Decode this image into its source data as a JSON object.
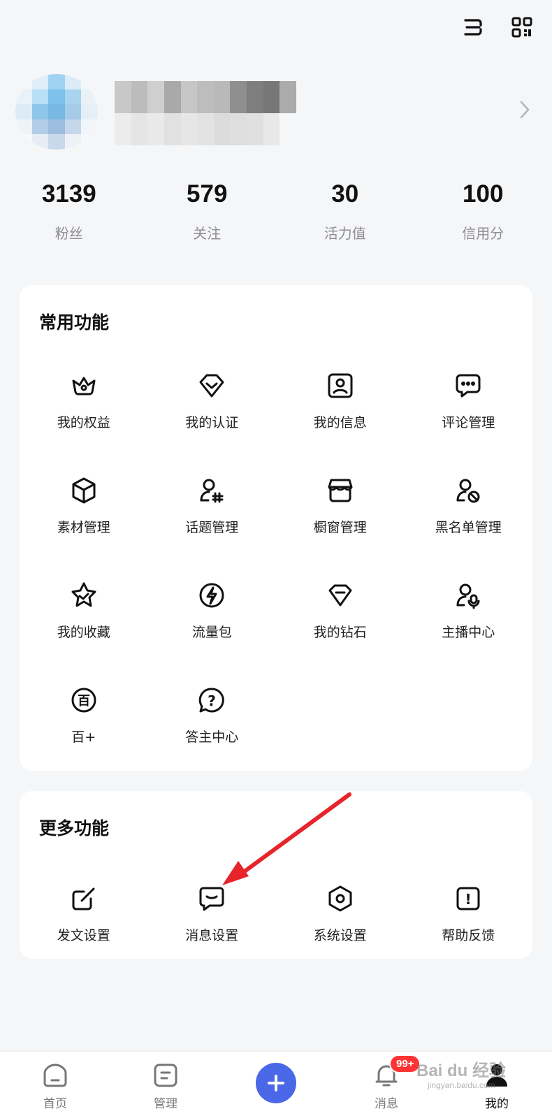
{
  "stats": [
    {
      "num": "3139",
      "label": "粉丝"
    },
    {
      "num": "579",
      "label": "关注"
    },
    {
      "num": "30",
      "label": "活力值"
    },
    {
      "num": "100",
      "label": "信用分"
    }
  ],
  "common": {
    "title": "常用功能",
    "items": [
      {
        "label": "我的权益",
        "icon": "crown-icon"
      },
      {
        "label": "我的认证",
        "icon": "badge-check-icon"
      },
      {
        "label": "我的信息",
        "icon": "profile-card-icon"
      },
      {
        "label": "评论管理",
        "icon": "comment-icon"
      },
      {
        "label": "素材管理",
        "icon": "cube-icon"
      },
      {
        "label": "话题管理",
        "icon": "user-hashtag-icon"
      },
      {
        "label": "橱窗管理",
        "icon": "storefront-icon"
      },
      {
        "label": "黑名单管理",
        "icon": "user-block-icon"
      },
      {
        "label": "我的收藏",
        "icon": "star-check-icon"
      },
      {
        "label": "流量包",
        "icon": "lightning-icon"
      },
      {
        "label": "我的钻石",
        "icon": "diamond-icon"
      },
      {
        "label": "主播中心",
        "icon": "user-mic-icon"
      },
      {
        "label": "百+",
        "icon": "bai-plus-icon",
        "glyph": "百"
      },
      {
        "label": "答主中心",
        "icon": "question-bubble-icon",
        "glyph": "?"
      }
    ]
  },
  "more": {
    "title": "更多功能",
    "items": [
      {
        "label": "发文设置",
        "icon": "edit-square-icon"
      },
      {
        "label": "消息设置",
        "icon": "message-icon"
      },
      {
        "label": "系统设置",
        "icon": "hex-settings-icon"
      },
      {
        "label": "帮助反馈",
        "icon": "exclamation-square-icon",
        "glyph": "!"
      }
    ]
  },
  "tabs": [
    {
      "label": "首页",
      "icon": "home-icon"
    },
    {
      "label": "管理",
      "icon": "manage-icon"
    },
    {
      "label": "",
      "icon": "plus-icon"
    },
    {
      "label": "消息",
      "icon": "bell-icon",
      "badge": "99+"
    },
    {
      "label": "我的",
      "icon": "user-icon"
    }
  ],
  "watermark": {
    "text": "Bai du 经验",
    "sub": "jingyan.baidu.com"
  },
  "colors": {
    "accent": "#4a67e8",
    "badge": "#ff3333",
    "arrow": "#e8242b"
  }
}
